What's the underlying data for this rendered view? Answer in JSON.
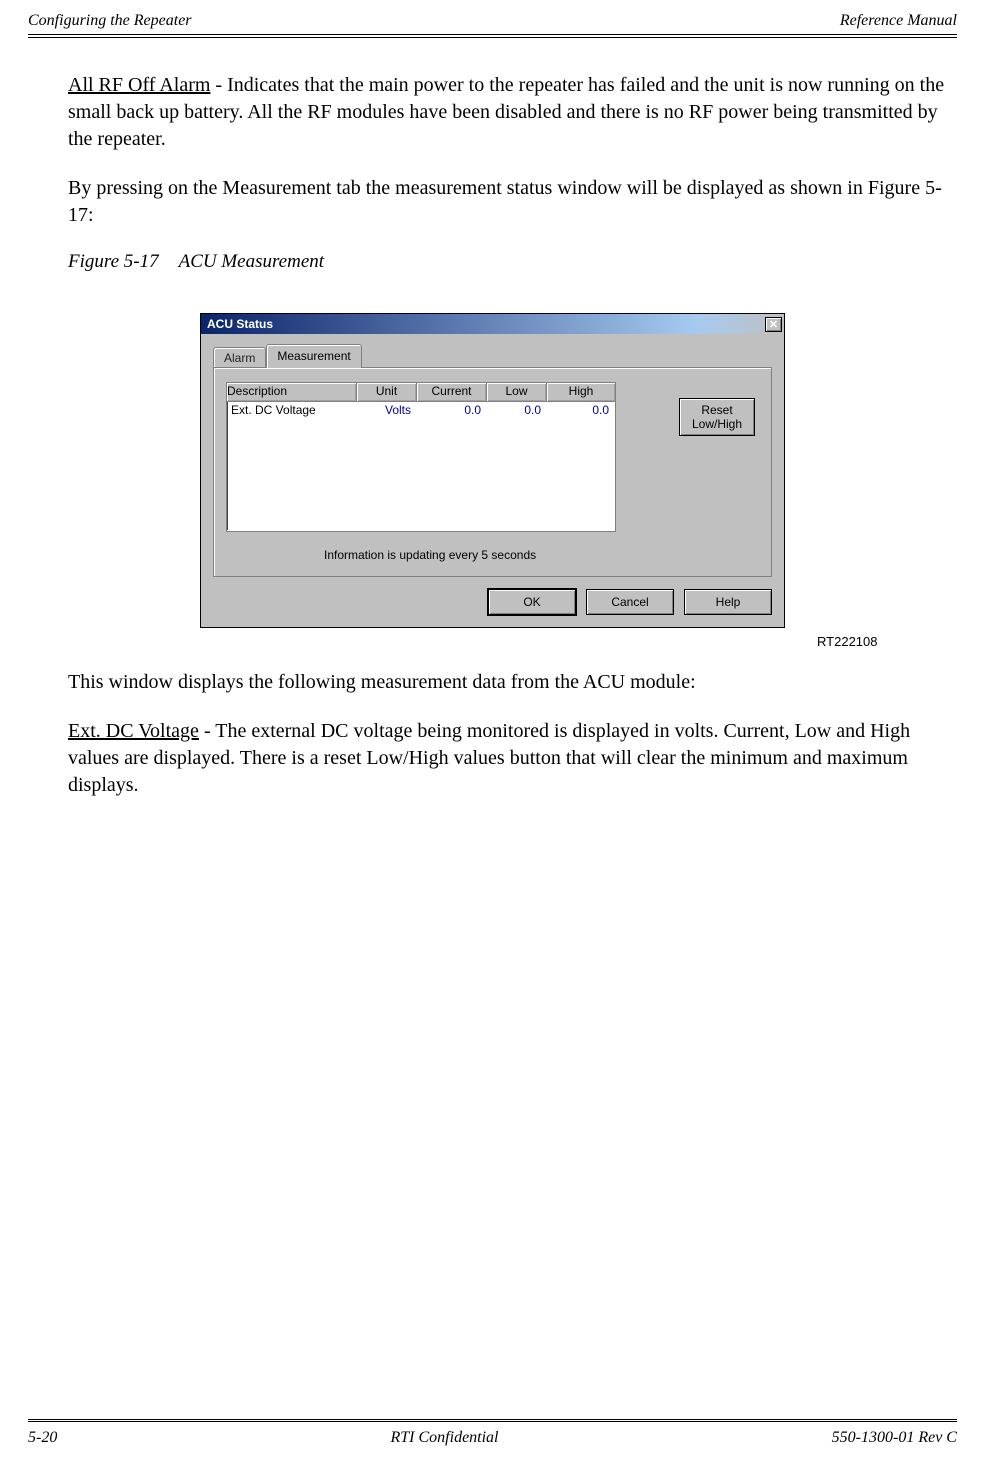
{
  "header": {
    "left": "Configuring the Repeater",
    "right": "Reference Manual"
  },
  "paragraphs": {
    "p1_term": "All RF Off Alarm",
    "p1_rest": " - Indicates that the main power to the repeater has failed and the unit is now running on the small back up battery. All the RF modules have been disabled and there is no RF power being transmitted by the repeater.",
    "p2": "By pressing on the Measurement tab the measurement status window will be displayed as shown in Figure 5-17:",
    "p3_lead": "This window displays the following measurement data from the ACU module:",
    "p4_term": "Ext. DC Voltage",
    "p4_rest": " - The external DC voltage being monitored is displayed in volts. Current, Low and High values are displayed. There is a reset Low/High values button that will clear the minimum and maximum displays."
  },
  "figure": {
    "label": "Figure 5-17",
    "title": "ACU Measurement",
    "rt_number": "RT222108"
  },
  "dialog": {
    "title": "ACU Status",
    "close_glyph": "✕",
    "tabs": {
      "alarm": "Alarm",
      "measurement": "Measurement"
    },
    "columns": {
      "desc": "Description",
      "unit": "Unit",
      "current": "Current",
      "low": "Low",
      "high": "High"
    },
    "row1": {
      "desc": "Ext. DC Voltage",
      "unit": "Volts",
      "current": "0.0",
      "low": "0.0",
      "high": "0.0"
    },
    "reset_btn_l1": "Reset",
    "reset_btn_l2": "Low/High",
    "info": "Information is updating every 5 seconds",
    "buttons": {
      "ok": "OK",
      "cancel": "Cancel",
      "help": "Help"
    }
  },
  "footer": {
    "left": "5-20",
    "center": "RTI Confidential",
    "right": "550-1300-01 Rev C"
  }
}
